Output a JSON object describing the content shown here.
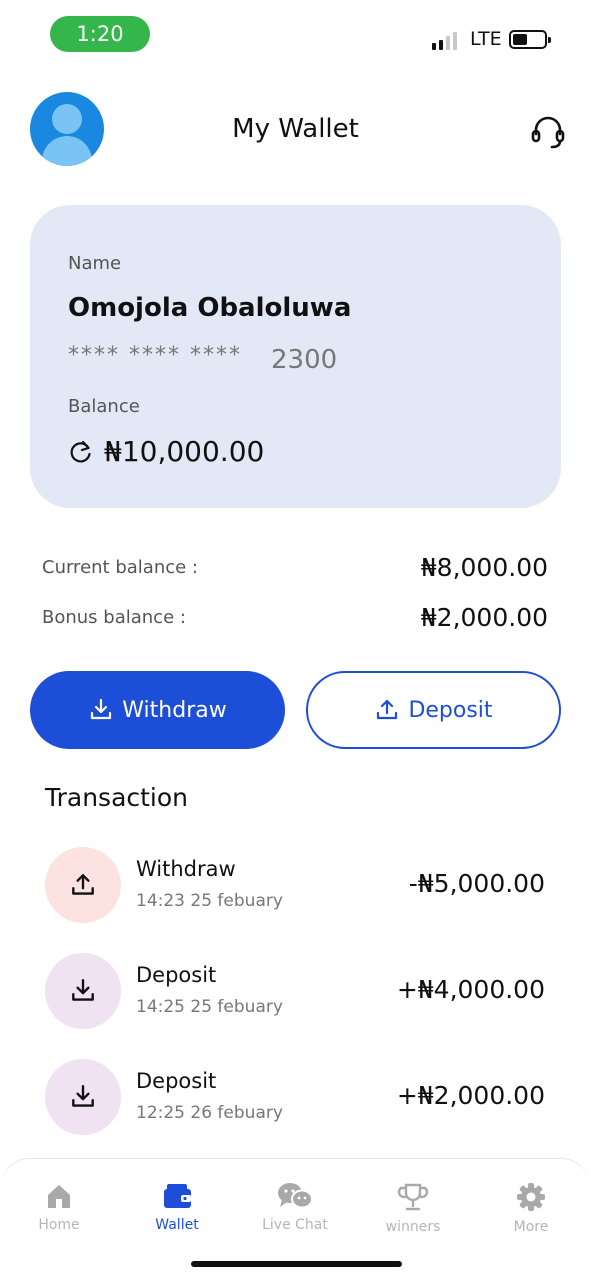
{
  "status_bar": {
    "time": "1:20",
    "network": "LTE",
    "colors": {
      "time_pill": "#34b64b"
    }
  },
  "header": {
    "title": "My Wallet",
    "avatar_icon": "user-avatar-icon",
    "support_icon": "headset-icon"
  },
  "card": {
    "name_label": "Name",
    "name": "Omojola Obaloluwa",
    "masked_groups": "****  ****  ****",
    "last_four": "2300",
    "balance_label": "Balance",
    "balance": "₦10,000.00",
    "refresh_icon": "refresh-icon",
    "background": "#e3e8f7"
  },
  "balances": {
    "current_label": "Current balance :",
    "current_value": "₦8,000.00",
    "bonus_label": "Bonus balance :",
    "bonus_value": "₦2,000.00"
  },
  "actions": {
    "withdraw_label": "Withdraw",
    "deposit_label": "Deposit",
    "accent": "#1d4ed8"
  },
  "transactions": {
    "title": "Transaction",
    "items": [
      {
        "type": "Withdraw",
        "date": "14:23 25 febuary",
        "amount": "-₦5,000.00",
        "icon": "upload-icon"
      },
      {
        "type": "Deposit",
        "date": "14:25 25 febuary",
        "amount": "+₦4,000.00",
        "icon": "download-icon"
      },
      {
        "type": "Deposit",
        "date": "12:25 26 febuary",
        "amount": "+₦2,000.00",
        "icon": "download-icon"
      }
    ]
  },
  "nav": {
    "items": [
      {
        "label": "Home",
        "icon": "home-icon"
      },
      {
        "label": "Wallet",
        "icon": "wallet-icon",
        "active": true
      },
      {
        "label": "Live Chat",
        "icon": "chat-icon"
      },
      {
        "label": "winners",
        "icon": "trophy-icon"
      },
      {
        "label": "More",
        "icon": "gear-icon"
      }
    ]
  }
}
